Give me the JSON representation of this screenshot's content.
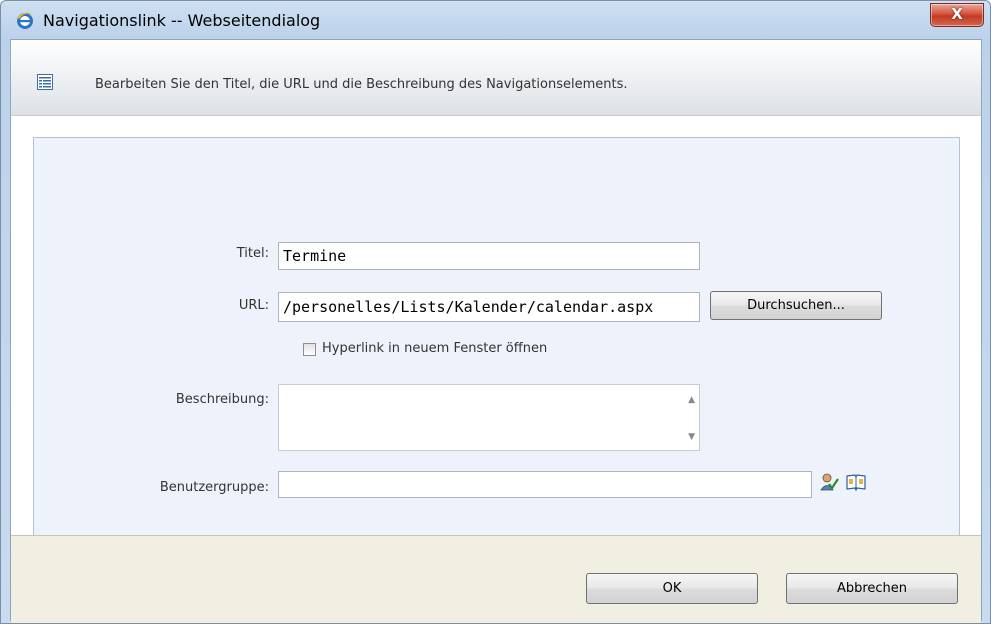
{
  "window": {
    "title": "Navigationslink -- Webseitendialog",
    "close_label": "X"
  },
  "description": {
    "text": "Bearbeiten Sie den Titel, die URL und die Beschreibung des Navigationselements."
  },
  "form": {
    "title_label": "Titel:",
    "title_value": "Termine",
    "url_label": "URL:",
    "url_value": "/personelles/Lists/Kalender/calendar.aspx",
    "browse_label": "Durchsuchen...",
    "new_window_label": "Hyperlink in neuem Fenster öffnen",
    "new_window_checked": false,
    "description_label": "Beschreibung:",
    "description_value": "",
    "audience_label": "Benutzergruppe:",
    "audience_value": ""
  },
  "footer": {
    "ok_label": "OK",
    "cancel_label": "Abbrechen"
  },
  "colors": {
    "close_red": "#c23a22",
    "panel_blue": "#eef3fb",
    "footer_beige": "#f1efe2"
  }
}
